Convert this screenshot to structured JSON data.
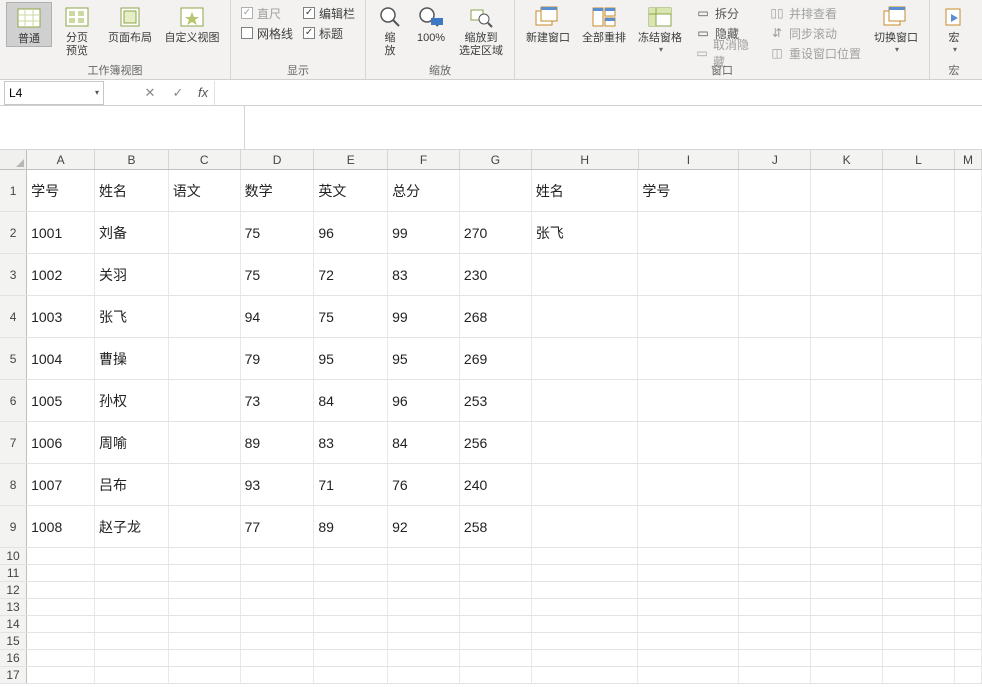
{
  "ribbon": {
    "groups": {
      "workbook_view": {
        "label": "工作簿视图",
        "normal": "普通",
        "page_break": "分页\n预览",
        "page_layout": "页面布局",
        "custom_view": "自定义视图"
      },
      "show": {
        "label": "显示",
        "ruler": "直尺",
        "formula_bar": "编辑栏",
        "gridlines": "网格线",
        "headings": "标题"
      },
      "zoom": {
        "label": "缩放",
        "zoom": "缩\n放",
        "p100": "100%",
        "to_selection": "缩放到\n选定区域"
      },
      "window": {
        "label": "窗口",
        "new_window": "新建窗口",
        "arrange_all": "全部重排",
        "freeze": "冻结窗格",
        "split": "拆分",
        "hide": "隐藏",
        "unhide": "取消隐藏",
        "side_by_side": "并排查看",
        "sync_scroll": "同步滚动",
        "reset_pos": "重设窗口位置",
        "switch": "切换窗口"
      },
      "macro": {
        "label": "宏",
        "macro": "宏"
      }
    }
  },
  "namebox": {
    "value": "L4"
  },
  "formula": {
    "value": ""
  },
  "columns": [
    "A",
    "B",
    "C",
    "D",
    "E",
    "F",
    "G",
    "H",
    "I",
    "J",
    "K",
    "L",
    "M"
  ],
  "headers": {
    "A": "学号",
    "B": "姓名",
    "C": "语文",
    "D": "数学",
    "E": "英文",
    "F": "总分",
    "H": "姓名",
    "I": "学号"
  },
  "rows": [
    {
      "A": "1001",
      "B": "刘备",
      "D": "75",
      "E": "96",
      "F": "99",
      "G": "270",
      "H": "张飞"
    },
    {
      "A": "1002",
      "B": "关羽",
      "D": "75",
      "E": "72",
      "F": "83",
      "G": "230"
    },
    {
      "A": "1003",
      "B": "张飞",
      "D": "94",
      "E": "75",
      "F": "99",
      "G": "268"
    },
    {
      "A": "1004",
      "B": "曹操",
      "D": "79",
      "E": "95",
      "F": "95",
      "G": "269"
    },
    {
      "A": "1005",
      "B": "孙权",
      "D": "73",
      "E": "84",
      "F": "96",
      "G": "253"
    },
    {
      "A": "1006",
      "B": "周喻",
      "D": "89",
      "E": "83",
      "F": "84",
      "G": "256"
    },
    {
      "A": "1007",
      "B": "吕布",
      "D": "93",
      "E": "71",
      "F": "76",
      "G": "240"
    },
    {
      "A": "1008",
      "B": "赵子龙",
      "D": "77",
      "E": "89",
      "F": "92",
      "G": "258"
    }
  ],
  "small_row_labels": [
    "10",
    "11",
    "12",
    "13",
    "14",
    "15",
    "16",
    "17"
  ]
}
